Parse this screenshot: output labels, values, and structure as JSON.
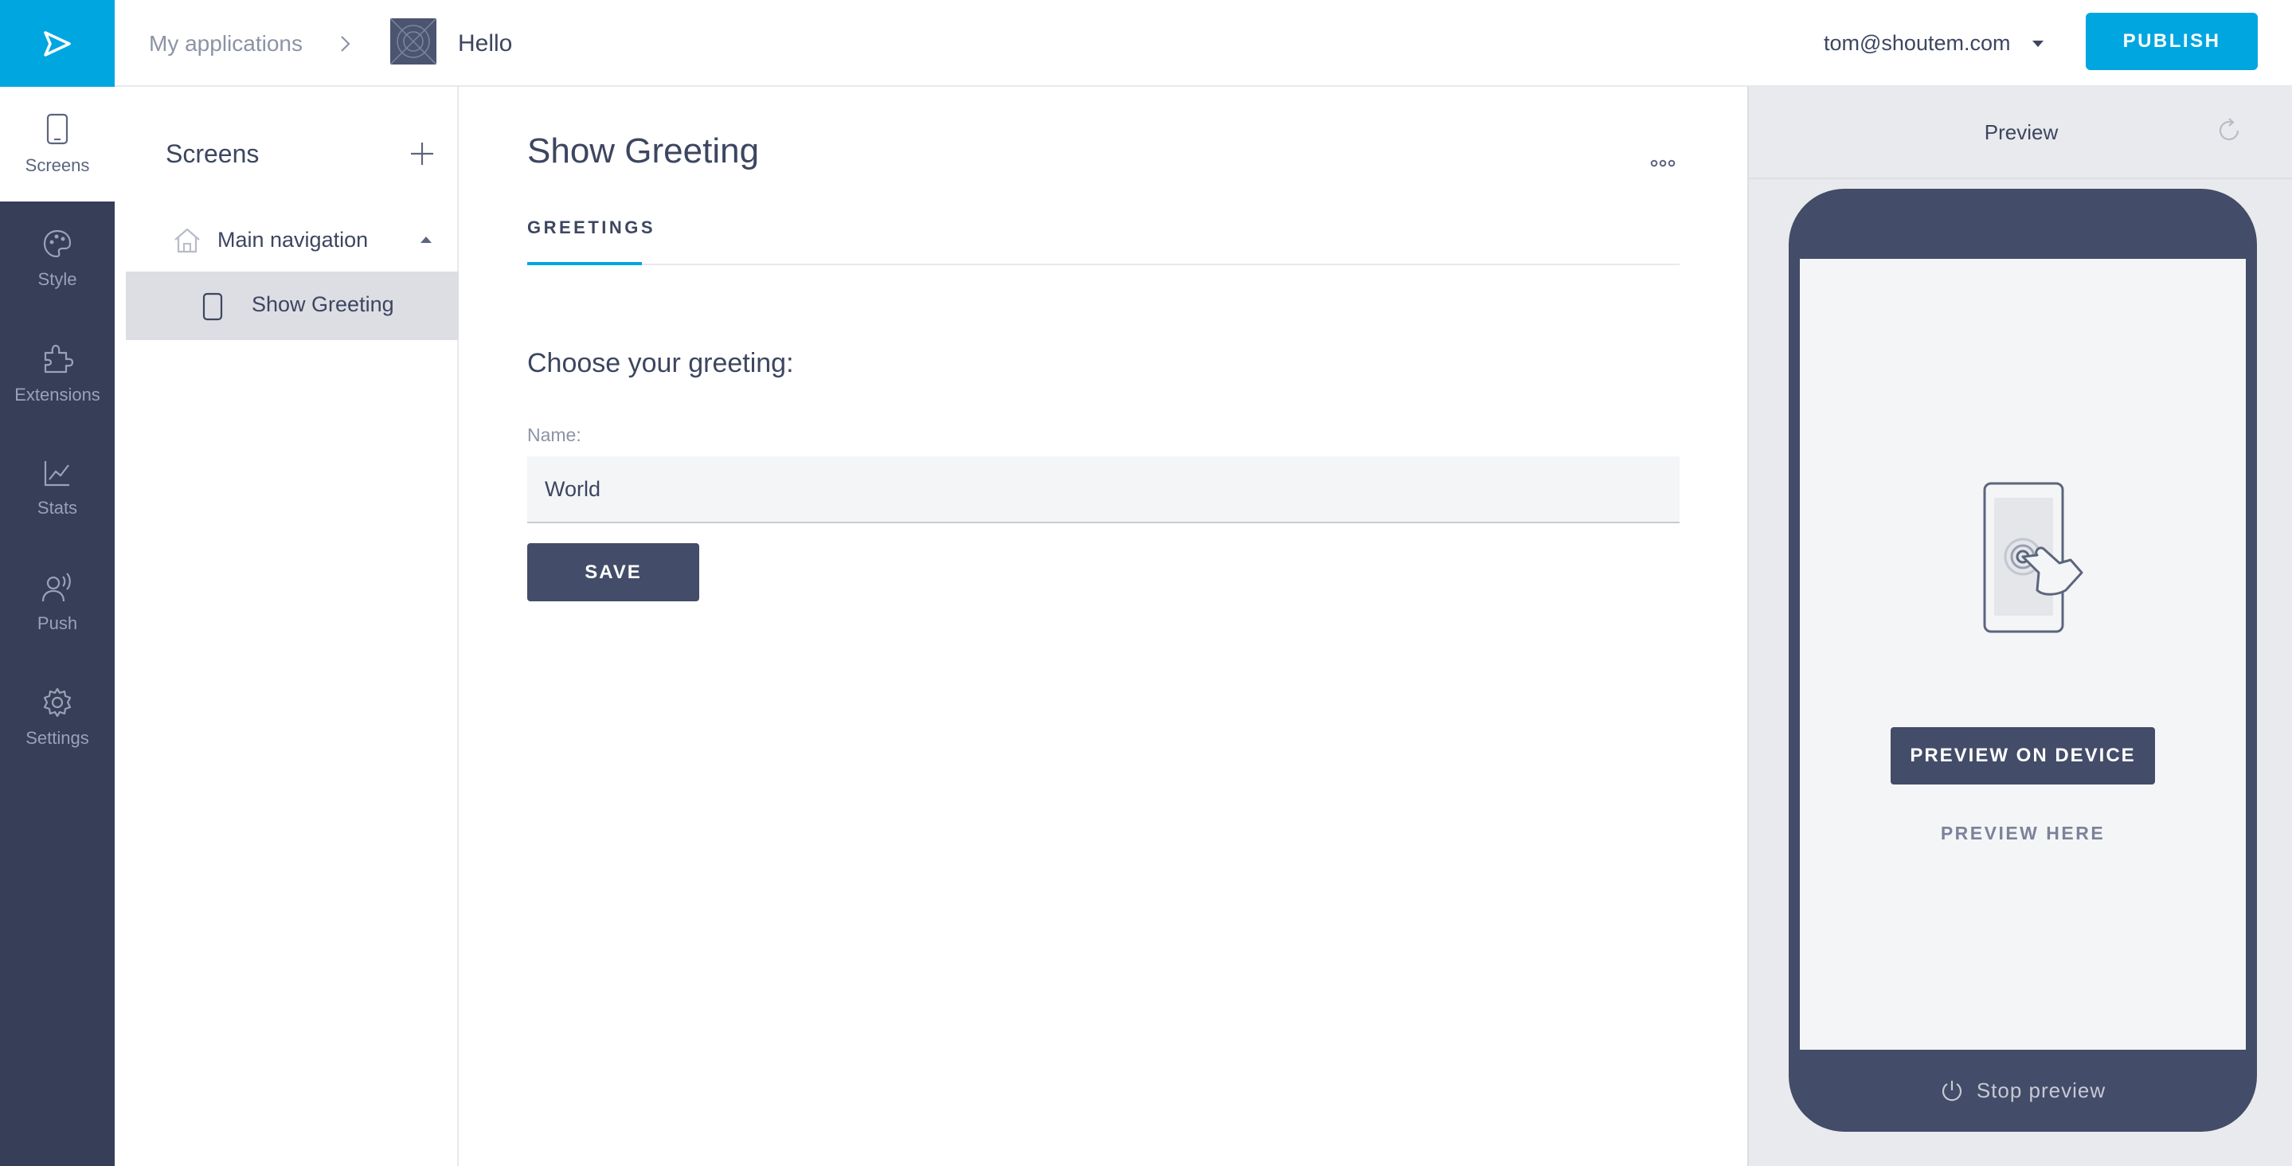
{
  "topbar": {
    "breadcrumb_root": "My applications",
    "app_name": "Hello",
    "account_email": "tom@shoutem.com",
    "publish_label": "PUBLISH"
  },
  "rail": {
    "items": [
      {
        "label": "Screens",
        "icon": "phone-icon"
      },
      {
        "label": "Style",
        "icon": "palette-icon"
      },
      {
        "label": "Extensions",
        "icon": "puzzle-icon"
      },
      {
        "label": "Stats",
        "icon": "chart-icon"
      },
      {
        "label": "Push",
        "icon": "push-icon"
      },
      {
        "label": "Settings",
        "icon": "gear-icon"
      }
    ],
    "active": "Screens"
  },
  "screens_panel": {
    "title": "Screens",
    "nav_label": "Main navigation",
    "screen_label": "Show Greeting"
  },
  "main": {
    "title": "Show Greeting",
    "tab_label": "GREETINGS",
    "section_heading": "Choose your greeting:",
    "field_label": "Name:",
    "field_value": "World",
    "save_label": "SAVE"
  },
  "preview": {
    "title": "Preview",
    "preview_on_device_label": "PREVIEW ON DEVICE",
    "preview_here_label": "PREVIEW HERE",
    "stop_preview_label": "Stop preview"
  },
  "colors": {
    "accent": "#00a6e0",
    "rail_bg": "#363e58",
    "dark_button": "#434c68",
    "text": "#3d4660"
  }
}
